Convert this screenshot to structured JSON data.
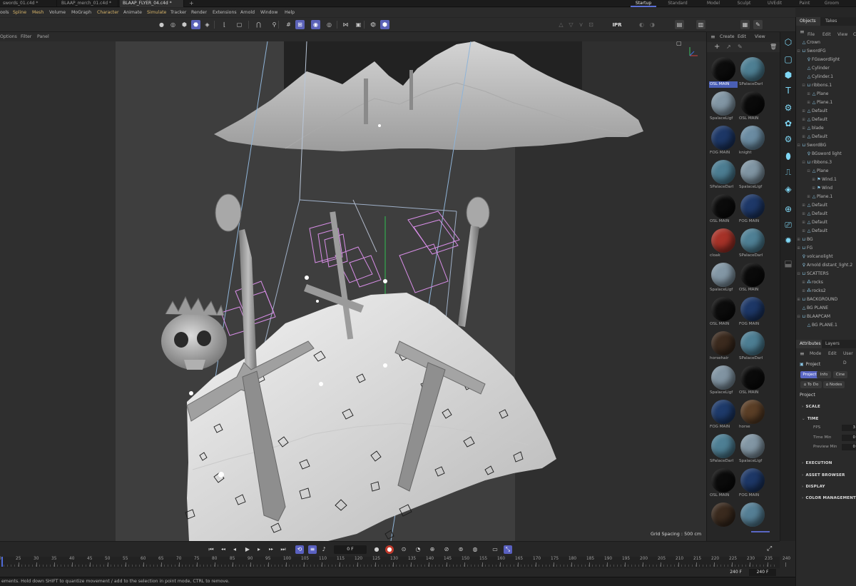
{
  "file_tabs": [
    {
      "label": "swords_01.c4d *",
      "active": false
    },
    {
      "label": "BLAAP_merch_01.c4d *",
      "active": false
    },
    {
      "label": "BLAAP_FLYER_04.c4d *",
      "active": true
    }
  ],
  "new_tab_symbol": "+",
  "layouts": [
    {
      "label": "Startup",
      "active": true
    },
    {
      "label": "Standard",
      "active": false
    },
    {
      "label": "Model",
      "active": false
    },
    {
      "label": "Sculpt",
      "active": false
    },
    {
      "label": "UVEdit",
      "active": false
    },
    {
      "label": "Paint",
      "active": false
    },
    {
      "label": "Groom",
      "active": false
    }
  ],
  "menu": [
    {
      "label": "ools",
      "hl": false
    },
    {
      "label": "Spline",
      "hl": true
    },
    {
      "label": "Mesh",
      "hl": true
    },
    {
      "label": "Volume",
      "hl": false
    },
    {
      "label": "MoGraph",
      "hl": false
    },
    {
      "label": "Character",
      "hl": true
    },
    {
      "label": "Animate",
      "hl": false
    },
    {
      "label": "Simulate",
      "hl": true
    },
    {
      "label": "Tracker",
      "hl": false
    },
    {
      "label": "Render",
      "hl": false
    },
    {
      "label": "Extensions",
      "hl": false
    },
    {
      "label": "Arnold",
      "hl": false
    },
    {
      "label": "Window",
      "hl": false
    },
    {
      "label": "Help",
      "hl": false
    }
  ],
  "toolbar": {
    "ipr_label": "IPR",
    "icons": [
      {
        "name": "points-mode-icon",
        "glyph": "●",
        "on": false
      },
      {
        "name": "edges-mode-icon",
        "glyph": "◎",
        "on": false
      },
      {
        "name": "polygons-mode-icon",
        "glyph": "⬢",
        "on": false
      },
      {
        "name": "model-mode-icon",
        "glyph": "⬣",
        "on": true
      },
      {
        "name": "uv-mode-icon",
        "glyph": "◈",
        "on": false
      },
      {
        "name": "axis-icon",
        "glyph": "⌊",
        "on": false
      },
      {
        "name": "lock-axis-icon",
        "glyph": "▢",
        "on": false
      },
      {
        "name": "magnet-icon",
        "glyph": "⋂",
        "on": false
      },
      {
        "name": "snap-icon",
        "glyph": "⚲",
        "on": false
      },
      {
        "name": "grid-snap-icon",
        "glyph": "#",
        "on": false
      },
      {
        "name": "workplane-icon",
        "glyph": "⊞",
        "on": true
      },
      {
        "name": "solo-icon",
        "glyph": "◉",
        "on": true
      },
      {
        "name": "symmetry-icon",
        "glyph": "◎",
        "on": false
      },
      {
        "name": "mirror-icon",
        "glyph": "⋈",
        "on": false
      },
      {
        "name": "tweak-icon",
        "glyph": "▣",
        "on": false
      },
      {
        "name": "settings-icon",
        "glyph": "⚙",
        "on": false
      },
      {
        "name": "object-icon",
        "glyph": "⬡",
        "on": false
      },
      {
        "name": "scene-icon",
        "glyph": "⬢",
        "on": true
      }
    ],
    "right_icons": [
      {
        "name": "render-region-icon",
        "glyph": "△"
      },
      {
        "name": "render-view-icon",
        "glyph": "▽"
      },
      {
        "name": "render-pv-icon",
        "glyph": "⋎"
      },
      {
        "name": "render-queue-icon",
        "glyph": "⊡"
      },
      {
        "name": "arnold-render-icon",
        "glyph": "◐"
      },
      {
        "name": "arnold-ipr-icon",
        "glyph": "◑"
      },
      {
        "name": "select-icon",
        "glyph": "▤"
      },
      {
        "name": "save-icon",
        "glyph": "▥"
      },
      {
        "name": "save-as-icon",
        "glyph": "▦"
      },
      {
        "name": "brush-icon",
        "glyph": "✎"
      }
    ]
  },
  "viewport_header": {
    "items": [
      "Options",
      "Filter",
      "Panel"
    ],
    "grid_spacing": "Grid Spacing : 500 cm"
  },
  "material_panel": {
    "menu": [
      "Create",
      "Edit",
      "View"
    ],
    "materials": [
      {
        "name": "OSL MAIN",
        "color": "#0c0c0c",
        "selected": true
      },
      {
        "name": "SPalaceDarl",
        "color": "#4e7f93"
      },
      {
        "name": "SpalaceLigf",
        "color": "#8296a4"
      },
      {
        "name": "OSL MAIN",
        "color": "#0a0a0a"
      },
      {
        "name": "FOG MAIN",
        "color": "#1d3766"
      },
      {
        "name": "knight",
        "color": "#6b8ca2"
      },
      {
        "name": "SPalaceDarl",
        "color": "#4c7d92"
      },
      {
        "name": "SpalaceLigf",
        "color": "#8095a3"
      },
      {
        "name": "OSL MAIN",
        "color": "#0b0b0b"
      },
      {
        "name": "FOG MAIN",
        "color": "#1e3868"
      },
      {
        "name": "cloak",
        "color": "#a63228"
      },
      {
        "name": "SPalaceDarl",
        "color": "#4f8095"
      },
      {
        "name": "SpalaceLigf",
        "color": "#8397a5"
      },
      {
        "name": "OSL MAIN",
        "color": "#0a0a0a"
      },
      {
        "name": "OSL MAIN",
        "color": "#0c0c0c"
      },
      {
        "name": "FOG MAIN",
        "color": "#1d3766"
      },
      {
        "name": "horsehair",
        "color": "#3b2a1e"
      },
      {
        "name": "SPalaceDarl",
        "color": "#4d7e93"
      },
      {
        "name": "SpalaceLigf",
        "color": "#8194a2"
      },
      {
        "name": "OSL MAIN",
        "color": "#0a0a0a"
      },
      {
        "name": "FOG MAIN",
        "color": "#1e3a6a"
      },
      {
        "name": "horse",
        "color": "#5a3e26"
      },
      {
        "name": "SPalaceDarl",
        "color": "#4e7f94"
      },
      {
        "name": "SpalaceLigf",
        "color": "#8296a4"
      },
      {
        "name": "OSL MAIN",
        "color": "#0b0b0b"
      },
      {
        "name": "FOG MAIN",
        "color": "#1d3766"
      },
      {
        "name": "",
        "color": "#3a2a1e"
      },
      {
        "name": "",
        "color": "#557f95"
      }
    ]
  },
  "objects_panel": {
    "tabs": [
      "Objects",
      "Takes"
    ],
    "menu": [
      "File",
      "Edit",
      "View",
      "C"
    ],
    "items": [
      {
        "label": "Crown",
        "depth": 0,
        "icon": "△",
        "exp": ""
      },
      {
        "label": "SwordFG",
        "depth": 0,
        "icon": "⊔",
        "exp": "⊟"
      },
      {
        "label": "FGswordlight",
        "depth": 1,
        "icon": "♀",
        "exp": ""
      },
      {
        "label": "Cylinder",
        "depth": 1,
        "icon": "△",
        "exp": ""
      },
      {
        "label": "Cylinder.1",
        "depth": 1,
        "icon": "△",
        "exp": ""
      },
      {
        "label": "ribbons.1",
        "depth": 1,
        "icon": "⊔",
        "exp": "⊟"
      },
      {
        "label": "Plane",
        "depth": 2,
        "icon": "△",
        "exp": "⊞"
      },
      {
        "label": "Plane.1",
        "depth": 2,
        "icon": "△",
        "exp": "⊞"
      },
      {
        "label": "Default",
        "depth": 1,
        "icon": "△",
        "exp": "⊞"
      },
      {
        "label": "Default",
        "depth": 1,
        "icon": "△",
        "exp": "⊞"
      },
      {
        "label": "blade",
        "depth": 1,
        "icon": "△",
        "exp": "⊞"
      },
      {
        "label": "Default",
        "depth": 1,
        "icon": "△",
        "exp": "⊞"
      },
      {
        "label": "SwordBG",
        "depth": 0,
        "icon": "⊔",
        "exp": "⊟"
      },
      {
        "label": "BGsword light",
        "depth": 1,
        "icon": "♀",
        "exp": ""
      },
      {
        "label": "ribbons.3",
        "depth": 1,
        "icon": "⊔",
        "exp": "⊟"
      },
      {
        "label": "Plane",
        "depth": 2,
        "icon": "△",
        "exp": "⊟"
      },
      {
        "label": "Wind.1",
        "depth": 3,
        "icon": "⚑",
        "exp": "⊞"
      },
      {
        "label": "Wind",
        "depth": 3,
        "icon": "⚑",
        "exp": "⊞"
      },
      {
        "label": "Plane.1",
        "depth": 2,
        "icon": "△",
        "exp": "⊞"
      },
      {
        "label": "Default",
        "depth": 1,
        "icon": "△",
        "exp": "⊞"
      },
      {
        "label": "Default",
        "depth": 1,
        "icon": "△",
        "exp": "⊞"
      },
      {
        "label": "Default",
        "depth": 1,
        "icon": "△",
        "exp": "⊞"
      },
      {
        "label": "Default",
        "depth": 1,
        "icon": "△",
        "exp": "⊞"
      },
      {
        "label": "BG",
        "depth": 0,
        "icon": "⊔",
        "exp": "⊞"
      },
      {
        "label": "FG",
        "depth": 0,
        "icon": "⊔",
        "exp": "⊞"
      },
      {
        "label": "volcanolight",
        "depth": 0,
        "icon": "♀",
        "exp": ""
      },
      {
        "label": "Arnold distant_light.2",
        "depth": 0,
        "icon": "♀",
        "exp": ""
      },
      {
        "label": "SCATTERS",
        "depth": 0,
        "icon": "⊔",
        "exp": "⊟"
      },
      {
        "label": "rocks",
        "depth": 1,
        "icon": "⁂",
        "exp": "⊞"
      },
      {
        "label": "rocks2",
        "depth": 1,
        "icon": "⁂",
        "exp": "⊞"
      },
      {
        "label": "BACKGROUND",
        "depth": 0,
        "icon": "⊔",
        "exp": "⊞"
      },
      {
        "label": "BG PLANE",
        "depth": 0,
        "icon": "△",
        "exp": ""
      },
      {
        "label": "BLAAPCAM",
        "depth": 0,
        "icon": "⊔",
        "exp": "⊟"
      },
      {
        "label": "BG PLANE.1",
        "depth": 1,
        "icon": "△",
        "exp": ""
      }
    ]
  },
  "attributes_panel": {
    "tabs": [
      "Attributes",
      "Layers"
    ],
    "menu": [
      "Mode",
      "Edit",
      "User D"
    ],
    "object_label": "Project",
    "buttons": [
      {
        "label": "Project",
        "on": true
      },
      {
        "label": "Info",
        "on": false
      },
      {
        "label": "Cine",
        "on": false
      }
    ],
    "buttons2": [
      "To Do",
      "Nodes"
    ],
    "section_title": "Project",
    "sections": [
      "SCALE",
      "TIME",
      "EXECUTION",
      "ASSET BROWSER",
      "DISPLAY",
      "COLOR MANAGEMENT"
    ],
    "time_fields": [
      "FPS",
      "Time Min",
      "Preview Min"
    ],
    "time_values": [
      "3",
      "0",
      "0"
    ]
  },
  "transport": {
    "frame": "0 F",
    "icons": [
      {
        "name": "go-to-start-icon",
        "glyph": "⏮",
        "type": ""
      },
      {
        "name": "prev-key-icon",
        "glyph": "◂◂",
        "type": ""
      },
      {
        "name": "prev-frame-icon",
        "glyph": "◂",
        "type": ""
      },
      {
        "name": "play-icon",
        "glyph": "▶",
        "type": ""
      },
      {
        "name": "next-frame-icon",
        "glyph": "▸",
        "type": ""
      },
      {
        "name": "next-key-icon",
        "glyph": "▸▸",
        "type": ""
      },
      {
        "name": "go-to-end-icon",
        "glyph": "⏭",
        "type": ""
      },
      {
        "name": "loop-icon",
        "glyph": "⟲",
        "type": "on"
      },
      {
        "name": "fps-icon",
        "glyph": "≡",
        "type": "on"
      },
      {
        "name": "sound-icon",
        "glyph": "♪",
        "type": ""
      }
    ],
    "icons2": [
      {
        "name": "record-keys-icon",
        "glyph": "●",
        "type": ""
      },
      {
        "name": "autokey-icon",
        "glyph": "●",
        "type": "red"
      },
      {
        "name": "keyframe-selection-icon",
        "glyph": "⊙",
        "type": ""
      },
      {
        "name": "timer-icon",
        "glyph": "◔",
        "type": ""
      },
      {
        "name": "move-key-icon",
        "glyph": "⊕",
        "type": ""
      },
      {
        "name": "rotate-key-icon",
        "glyph": "⊘",
        "type": ""
      },
      {
        "name": "scale-key-icon",
        "glyph": "⊚",
        "type": ""
      },
      {
        "name": "param-key-icon",
        "glyph": "◍",
        "type": ""
      },
      {
        "name": "pla-key-icon",
        "glyph": "▭",
        "type": ""
      },
      {
        "name": "interpolation-icon",
        "glyph": "⤡",
        "type": "on"
      }
    ]
  },
  "timeline": {
    "ticks": [
      "0",
      "25",
      "30",
      "35",
      "40",
      "45",
      "50",
      "55",
      "60",
      "65",
      "70",
      "75",
      "80",
      "85",
      "90",
      "95",
      "100",
      "105",
      "110",
      "115",
      "120",
      "125",
      "130",
      "135",
      "140",
      "145",
      "150",
      "155",
      "160",
      "165",
      "170",
      "175",
      "180",
      "185",
      "190",
      "195",
      "200",
      "205",
      "210",
      "215",
      "220",
      "225",
      "230",
      "235",
      "240"
    ],
    "end_frame": "240 F",
    "end_frame2": "240 F"
  },
  "status": "ements. Hold down SHIFT to quantize movement / add to the selection in point mode, CTRL to remove."
}
